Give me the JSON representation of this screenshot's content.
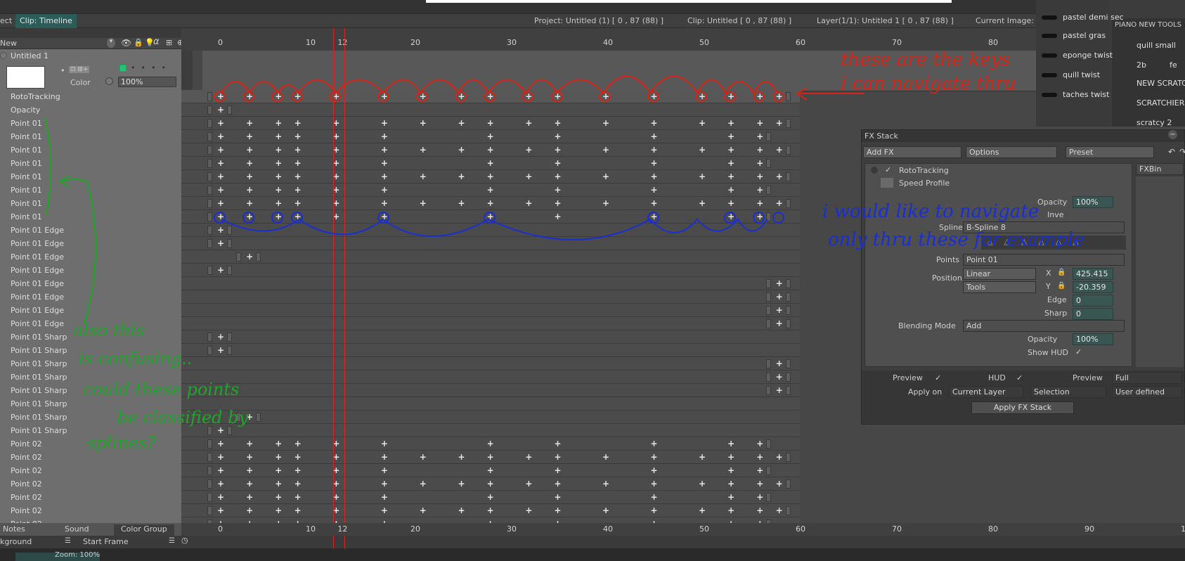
{
  "toolbar": {
    "left_label": "ect",
    "clip_tab": "Clip: Timeline",
    "project": "Project: Untitled (1) [ 0 , 87  (88) ]",
    "clip": "Clip: Untitled [ 0 , 87  (88) ]",
    "layer": "Layer(1/1): Untitled 1 [ 0 , 87  (88) ]",
    "current_image": "Current Image:"
  },
  "left_panel": {
    "header_label": "New",
    "layer_name": "Untitled 1",
    "color_label": "Color",
    "opacity_value": "100%",
    "tracks": [
      "RotoTracking",
      "Opacity",
      "Point 01",
      "Point 01",
      "Point 01",
      "Point 01",
      "Point 01",
      "Point 01",
      "Point 01",
      "Point 01",
      "Point 01 Edge",
      "Point 01 Edge",
      "Point 01 Edge",
      "Point 01 Edge",
      "Point 01 Edge",
      "Point 01 Edge",
      "Point 01 Edge",
      "Point 01 Edge",
      "Point 01 Sharp",
      "Point 01 Sharp",
      "Point 01 Sharp",
      "Point 01 Sharp",
      "Point 01 Sharp",
      "Point 01 Sharp",
      "Point 01 Sharp",
      "Point 01 Sharp",
      "Point 02",
      "Point 02",
      "Point 02",
      "Point 02",
      "Point 02",
      "Point 02",
      "Point 02"
    ],
    "tabs": [
      "Notes",
      "Sound",
      "Color Group"
    ],
    "bottom_left": "kground",
    "start_frame": "Start Frame"
  },
  "ruler_ticks": [
    "0",
    "10",
    "12",
    "20",
    "30",
    "40",
    "50",
    "60",
    "70",
    "80",
    "90",
    "10"
  ],
  "fx_stack": {
    "title": "FX Stack",
    "add_fx": "Add FX",
    "options": "Options",
    "preset": "Preset",
    "fxbin": "FXBin",
    "effect_name": "RotoTracking",
    "speed_profile": "Speed Profile",
    "opacity_label": "Opacity",
    "opacity_value": "100%",
    "invert_label": "Inve",
    "spline_label": "Spline",
    "spline_value": "B-Spline 8",
    "points_label": "Points",
    "points_value": "Point 01",
    "position_label": "Position",
    "interp_value": "Linear",
    "tools_value": "Tools",
    "x_label": "X",
    "x_value": "425.415",
    "y_label": "Y",
    "y_value": "-20.359",
    "edge_label": "Edge",
    "edge_value": "0",
    "sharp_label": "Sharp",
    "sharp_value": "0",
    "blend_label": "Blending Mode",
    "blend_value": "Add",
    "opacity2_label": "Opacity",
    "opacity2_value": "100%",
    "hud_label": "Show HUD",
    "preview_label": "Preview",
    "hud2_label": "HUD",
    "preview2_label": "Preview",
    "preview_value": "Full",
    "apply_on_label": "Apply on",
    "apply_on_value": "Current Layer",
    "selection_value": "Selection",
    "user_defined_value": "User defined",
    "apply_button": "Apply FX Stack"
  },
  "brushes": {
    "left": [
      "pastel demi sec",
      "pastel gras",
      "eponge twist",
      "quill twist",
      "taches twist"
    ],
    "panel_title": "PIANO NEW TOOLS",
    "right": [
      "quill small",
      "2b",
      "fe",
      "NEW SCRATC",
      "SCRATCHIER",
      "scratcy 2"
    ]
  },
  "bottom": {
    "zoom": "Zoom: 100%"
  },
  "annotations": {
    "red": [
      "these are the keys",
      "i can navigate thru"
    ],
    "blue": [
      "i would like to navigate",
      "only thru these for example"
    ],
    "green": [
      "also this",
      "is confusing..",
      "could these points",
      "be classified by",
      "splines?"
    ]
  },
  "colors": {
    "red_ink": "#d42418",
    "blue_ink": "#1a2fd0",
    "green_ink": "#1fa52a",
    "accent": "#2fbf70"
  }
}
